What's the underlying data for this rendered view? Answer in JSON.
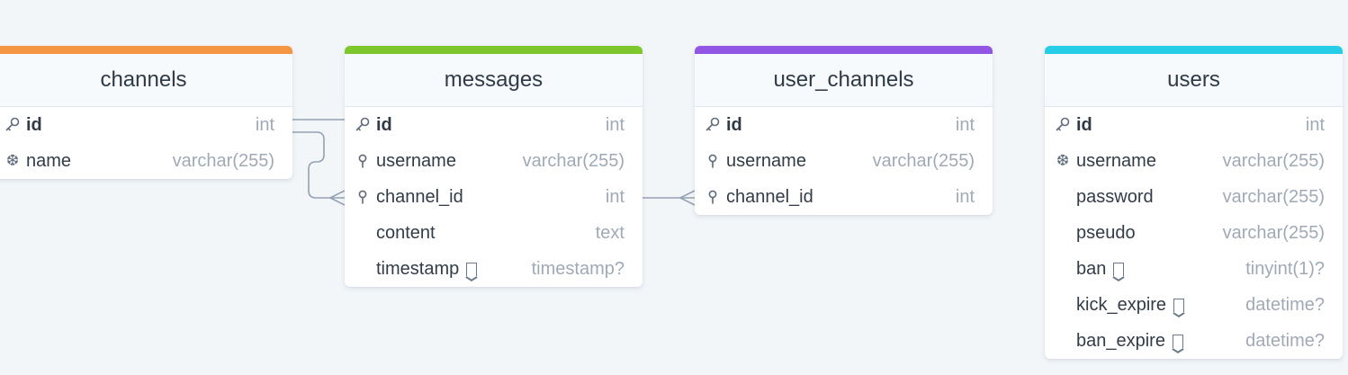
{
  "tables": [
    {
      "name": "channels",
      "accent": "#f59742",
      "columns": [
        {
          "name": "id",
          "type": "int",
          "icon": "key-icon",
          "pk": true,
          "note": false
        },
        {
          "name": "name",
          "type": "varchar(255)",
          "icon": "snowflake-icon",
          "pk": false,
          "note": false
        }
      ]
    },
    {
      "name": "messages",
      "accent": "#7dc62b",
      "columns": [
        {
          "name": "id",
          "type": "int",
          "icon": "key-icon",
          "pk": true,
          "note": false
        },
        {
          "name": "username",
          "type": "varchar(255)",
          "icon": "pin-icon",
          "pk": false,
          "note": false
        },
        {
          "name": "channel_id",
          "type": "int",
          "icon": "pin-icon",
          "pk": false,
          "note": false
        },
        {
          "name": "content",
          "type": "text",
          "icon": "",
          "pk": false,
          "note": false
        },
        {
          "name": "timestamp",
          "type": "timestamp?",
          "icon": "",
          "pk": false,
          "note": true
        }
      ]
    },
    {
      "name": "user_channels",
      "accent": "#9256e4",
      "columns": [
        {
          "name": "id",
          "type": "int",
          "icon": "key-icon",
          "pk": true,
          "note": false
        },
        {
          "name": "username",
          "type": "varchar(255)",
          "icon": "pin-icon",
          "pk": false,
          "note": false
        },
        {
          "name": "channel_id",
          "type": "int",
          "icon": "pin-icon",
          "pk": false,
          "note": false
        }
      ]
    },
    {
      "name": "users",
      "accent": "#27cce6",
      "columns": [
        {
          "name": "id",
          "type": "int",
          "icon": "key-icon",
          "pk": true,
          "note": false
        },
        {
          "name": "username",
          "type": "varchar(255)",
          "icon": "snowflake-icon",
          "pk": false,
          "note": false
        },
        {
          "name": "password",
          "type": "varchar(255)",
          "icon": "",
          "pk": false,
          "note": false
        },
        {
          "name": "pseudo",
          "type": "varchar(255)",
          "icon": "",
          "pk": false,
          "note": false
        },
        {
          "name": "ban",
          "type": "tinyint(1)?",
          "icon": "",
          "pk": false,
          "note": true
        },
        {
          "name": "kick_expire",
          "type": "datetime?",
          "icon": "",
          "pk": false,
          "note": true
        },
        {
          "name": "ban_expire",
          "type": "datetime?",
          "icon": "",
          "pk": false,
          "note": true
        }
      ]
    }
  ],
  "colors": {
    "connector": "#94a1b2"
  }
}
